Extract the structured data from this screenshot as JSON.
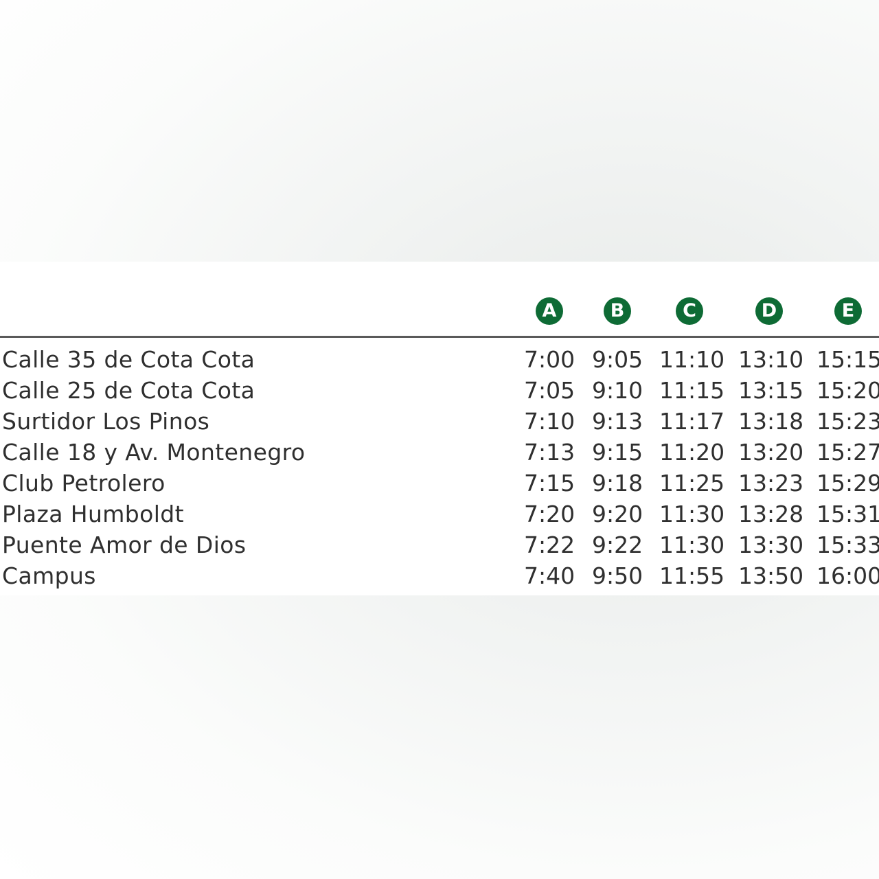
{
  "schedule": {
    "routes": [
      "A",
      "B",
      "C",
      "D",
      "E"
    ],
    "stops": [
      {
        "name": "Calle 35 de Cota Cota",
        "times": [
          "7:00",
          "9:05",
          "11:10",
          "13:10",
          "15:15"
        ]
      },
      {
        "name": "Calle 25 de Cota Cota",
        "times": [
          "7:05",
          "9:10",
          "11:15",
          "13:15",
          "15:20"
        ]
      },
      {
        "name": "Surtidor Los Pinos",
        "times": [
          "7:10",
          "9:13",
          "11:17",
          "13:18",
          "15:23"
        ]
      },
      {
        "name": "Calle 18 y Av. Montenegro",
        "times": [
          "7:13",
          "9:15",
          "11:20",
          "13:20",
          "15:27"
        ]
      },
      {
        "name": "Club Petrolero",
        "times": [
          "7:15",
          "9:18",
          "11:25",
          "13:23",
          "15:29"
        ]
      },
      {
        "name": "Plaza Humboldt",
        "times": [
          "7:20",
          "9:20",
          "11:30",
          "13:28",
          "15:31"
        ]
      },
      {
        "name": "Puente Amor de Dios",
        "times": [
          "7:22",
          "9:22",
          "11:30",
          "13:30",
          "15:33"
        ]
      },
      {
        "name": "Campus",
        "times": [
          "7:40",
          "9:50",
          "11:55",
          "13:50",
          "16:00"
        ]
      }
    ]
  },
  "colors": {
    "badge": "#0e6b35",
    "text": "#2f2f2f",
    "rule": "#5a5a5a"
  }
}
